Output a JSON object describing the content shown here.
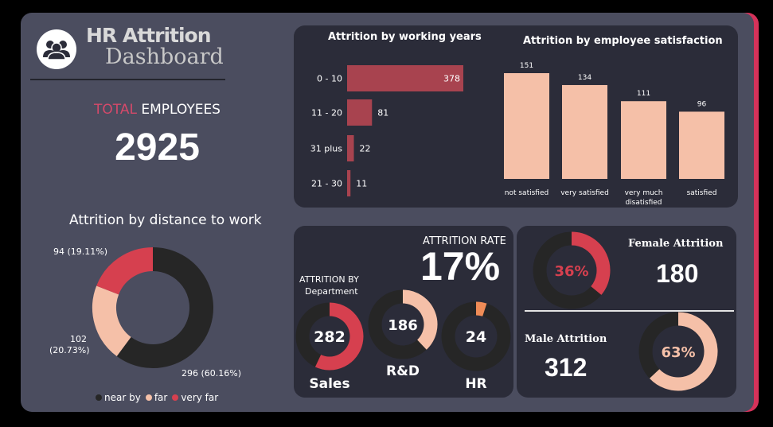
{
  "header": {
    "title_line1": "HR Attrition",
    "title_line2": "Dashboard",
    "logo_icon": "people-group-icon"
  },
  "total": {
    "label_part1": "TOTAL",
    "label_part2": "EMPLOYEES",
    "value": "2925"
  },
  "working_years": {
    "title": "Attrition by working years",
    "color": "#a8434f",
    "chart_data": {
      "type": "bar",
      "orientation": "horizontal",
      "categories": [
        "0 - 10",
        "11 - 20",
        "31 plus",
        "21 - 30"
      ],
      "values": [
        378,
        81,
        22,
        11
      ],
      "xlim": [
        0,
        378
      ]
    }
  },
  "satisfaction": {
    "title": "Attrition by employee satisfaction",
    "color": "#f5c0a8",
    "chart_data": {
      "type": "bar",
      "categories": [
        "not satisfied",
        "very satisfied",
        "very much disatisfied",
        "satisfied"
      ],
      "values": [
        151,
        134,
        111,
        96
      ],
      "ylim": [
        0,
        151
      ]
    }
  },
  "distance": {
    "title": "Attrition by distance to work",
    "chart_data": {
      "type": "pie",
      "categories": [
        "near by",
        "far",
        "very far"
      ],
      "values": [
        296,
        102,
        94
      ],
      "labels": [
        "296 (60.16%)",
        "102",
        "(20.73%)",
        "94 (19.11%)"
      ],
      "colors": [
        "#262626",
        "#f5c0a8",
        "#d6404f"
      ]
    },
    "legend": [
      "near by",
      "far",
      "very far"
    ]
  },
  "department": {
    "rate_label": "ATTRITION RATE",
    "rate_value": "17%",
    "by_label_line1": "ATTRITION BY",
    "by_label_line2": "Department",
    "items": [
      {
        "name": "Sales",
        "value": "282",
        "fraction": 0.57,
        "color": "#d6404f"
      },
      {
        "name": "R&D",
        "value": "186",
        "fraction": 0.38,
        "color": "#f5c0a8"
      },
      {
        "name": "HR",
        "value": "24",
        "fraction": 0.05,
        "color": "#f08c57"
      }
    ]
  },
  "gender": {
    "female_title": "Female Attrition",
    "female_value": "180",
    "female_percent": "36%",
    "female_fraction": 0.36,
    "female_color": "#d6404f",
    "male_title": "Male Attrition",
    "male_value": "312",
    "male_percent": "63%",
    "male_fraction": 0.63,
    "male_color": "#f5c0a8"
  }
}
